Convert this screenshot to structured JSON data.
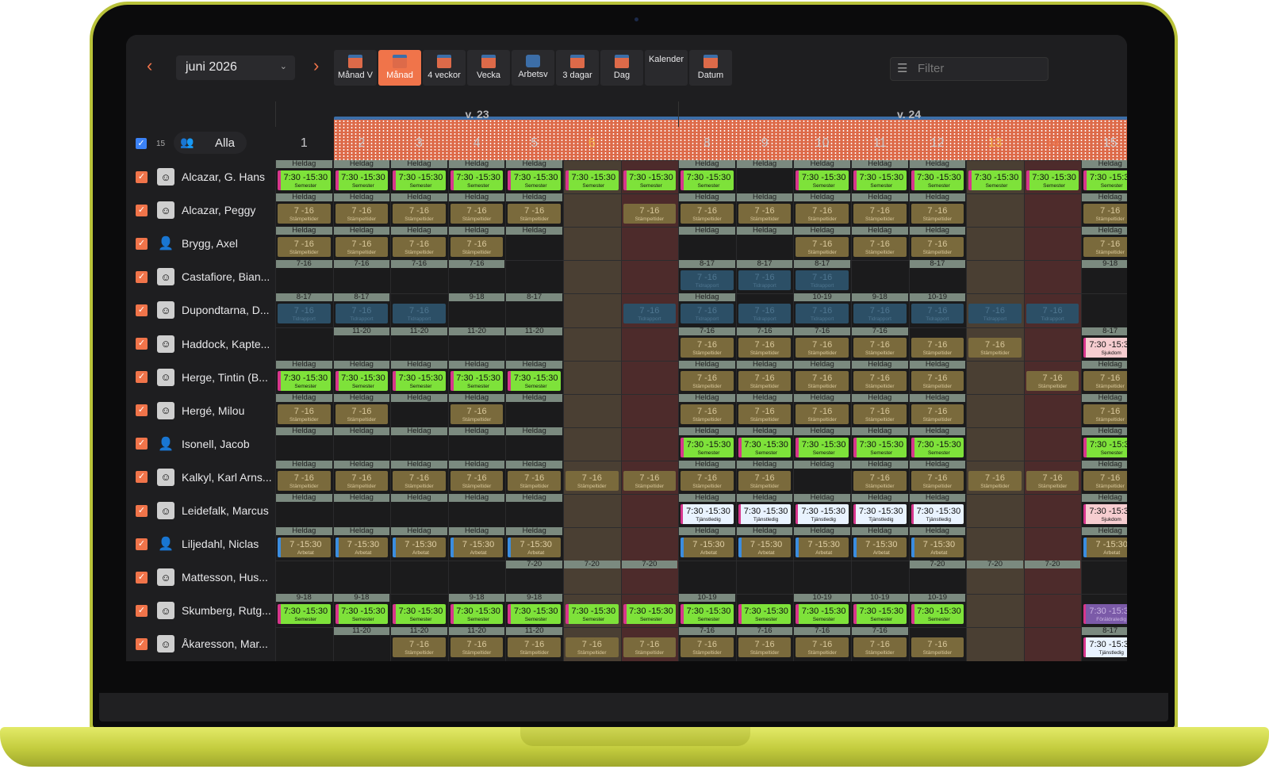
{
  "toolbar": {
    "month": "juni 2026",
    "views": [
      {
        "label": "Månad V",
        "icon": "calendar-icon"
      },
      {
        "label": "Månad",
        "icon": "calendar-icon",
        "active": true
      },
      {
        "label": "4 veckor",
        "icon": "calendar-icon"
      },
      {
        "label": "Vecka",
        "icon": "calendar-week-icon"
      },
      {
        "label": "Arbetsv",
        "icon": "briefcase-icon"
      },
      {
        "label": "3 dagar",
        "icon": "calendar-icon"
      },
      {
        "label": "Dag",
        "icon": "calendar-day-icon"
      },
      {
        "label": "Kalender",
        "icon": "calendar-grid-icon"
      },
      {
        "label": "Datum",
        "icon": "calendar-icon"
      }
    ],
    "filter_placeholder": "Filter"
  },
  "weeks": [
    {
      "label": "v. 23"
    },
    {
      "label": "v. 24"
    }
  ],
  "all": {
    "count": "15",
    "label": "Alla"
  },
  "days": [
    {
      "n": "1",
      "t": "wk"
    },
    {
      "n": "2",
      "t": "wk"
    },
    {
      "n": "3",
      "t": "wk"
    },
    {
      "n": "4",
      "t": "wk"
    },
    {
      "n": "5",
      "t": "wk"
    },
    {
      "n": "6",
      "t": "sat"
    },
    {
      "n": "7",
      "t": "sun"
    },
    {
      "n": "8",
      "t": "wk"
    },
    {
      "n": "9",
      "t": "wk"
    },
    {
      "n": "10",
      "t": "wk"
    },
    {
      "n": "11",
      "t": "wk"
    },
    {
      "n": "12",
      "t": "wk"
    },
    {
      "n": "13",
      "t": "sat"
    },
    {
      "n": "14",
      "t": "sun"
    },
    {
      "n": "15",
      "t": "wk"
    }
  ],
  "legend": {
    "sem": {
      "time": "7:30 -15:30",
      "label": "Semester"
    },
    "stamp": {
      "time": "7 -16",
      "label": "Stämpeltider"
    },
    "tid": {
      "time": "7 -16",
      "label": "Tidrapport"
    },
    "arb": {
      "time": "7 -15:30",
      "label": "Arbetat"
    },
    "tjan": {
      "time": "7:30 -15:30",
      "label": "Tjänstledig"
    },
    "sjuk": {
      "time": "7:30 -15:30",
      "label": "Sjukdom"
    },
    "parent": {
      "time": "7:30 -15:30",
      "label": "Föräldraledig"
    }
  },
  "people": [
    {
      "name": "Alcazar, G. Hans",
      "avatar": "person-photo-icon",
      "cells": [
        [
          "Heldag",
          "sem"
        ],
        [
          "Heldag",
          "sem"
        ],
        [
          "Heldag",
          "sem"
        ],
        [
          "Heldag",
          "sem"
        ],
        [
          "Heldag",
          "sem"
        ],
        [
          "",
          "sem"
        ],
        [
          "",
          "sem"
        ],
        [
          "Heldag",
          "sem"
        ],
        [
          "Heldag",
          ""
        ],
        [
          "Heldag",
          "sem"
        ],
        [
          "Heldag",
          "sem"
        ],
        [
          "Heldag",
          "sem"
        ],
        [
          "",
          "sem"
        ],
        [
          "",
          "sem"
        ],
        [
          "Heldag",
          "sem"
        ]
      ]
    },
    {
      "name": "Alcazar, Peggy",
      "avatar": "person-photo-icon",
      "cells": [
        [
          "Heldag",
          "stamp"
        ],
        [
          "Heldag",
          "stamp"
        ],
        [
          "Heldag",
          "stamp"
        ],
        [
          "Heldag",
          "stamp"
        ],
        [
          "Heldag",
          "stamp"
        ],
        [
          "",
          ""
        ],
        [
          "",
          "stamp"
        ],
        [
          "Heldag",
          "stamp"
        ],
        [
          "Heldag",
          "stamp"
        ],
        [
          "Heldag",
          "stamp"
        ],
        [
          "Heldag",
          "stamp"
        ],
        [
          "Heldag",
          "stamp"
        ],
        [
          "",
          ""
        ],
        [
          "",
          ""
        ],
        [
          "Heldag",
          "stamp"
        ]
      ]
    },
    {
      "name": "Brygg, Axel",
      "avatar": "generic-user-icon",
      "cells": [
        [
          "Heldag",
          "stamp"
        ],
        [
          "Heldag",
          "stamp"
        ],
        [
          "Heldag",
          "stamp"
        ],
        [
          "Heldag",
          "stamp"
        ],
        [
          "Heldag",
          ""
        ],
        [
          "",
          ""
        ],
        [
          "",
          ""
        ],
        [
          "Heldag",
          ""
        ],
        [
          "Heldag",
          ""
        ],
        [
          "Heldag",
          "stamp"
        ],
        [
          "Heldag",
          "stamp"
        ],
        [
          "Heldag",
          "stamp"
        ],
        [
          "",
          ""
        ],
        [
          "",
          ""
        ],
        [
          "Heldag",
          "stamp"
        ]
      ]
    },
    {
      "name": "Castafiore, Bian...",
      "avatar": "person-photo-icon",
      "cells": [
        [
          "7-16",
          ""
        ],
        [
          "7-16",
          ""
        ],
        [
          "7-16",
          ""
        ],
        [
          "7-16",
          ""
        ],
        [
          "",
          ""
        ],
        [
          "",
          ""
        ],
        [
          "",
          ""
        ],
        [
          "8-17",
          "tid"
        ],
        [
          "8-17",
          "tid"
        ],
        [
          "8-17",
          "tid"
        ],
        [
          "",
          ""
        ],
        [
          "8-17",
          ""
        ],
        [
          "",
          ""
        ],
        [
          "",
          ""
        ],
        [
          "9-18",
          ""
        ]
      ]
    },
    {
      "name": "Dupondtarna, D...",
      "avatar": "person-photo-icon",
      "cells": [
        [
          "8-17",
          "tid"
        ],
        [
          "8-17",
          "tid"
        ],
        [
          "",
          "tid"
        ],
        [
          "9-18",
          ""
        ],
        [
          "8-17",
          ""
        ],
        [
          "",
          ""
        ],
        [
          "",
          "tid"
        ],
        [
          "Heldag",
          "tid"
        ],
        [
          "",
          "tid"
        ],
        [
          "10-19",
          "tid"
        ],
        [
          "9-18",
          "tid"
        ],
        [
          "10-19",
          "tid"
        ],
        [
          "",
          "tid"
        ],
        [
          "",
          "tid"
        ],
        [
          "",
          ""
        ]
      ]
    },
    {
      "name": "Haddock, Kapte...",
      "avatar": "person-photo-icon",
      "cells": [
        [
          "",
          ""
        ],
        [
          "11-20",
          ""
        ],
        [
          "11-20",
          ""
        ],
        [
          "11-20",
          ""
        ],
        [
          "11-20",
          ""
        ],
        [
          "",
          ""
        ],
        [
          "",
          ""
        ],
        [
          "7-16",
          "stamp"
        ],
        [
          "7-16",
          "stamp"
        ],
        [
          "7-16",
          "stamp"
        ],
        [
          "7-16",
          "stamp"
        ],
        [
          "",
          "stamp"
        ],
        [
          "",
          "stamp"
        ],
        [
          "",
          ""
        ],
        [
          "8-17",
          "sjuk"
        ]
      ]
    },
    {
      "name": "Herge, Tintin (B...",
      "avatar": "person-photo-icon",
      "cells": [
        [
          "Heldag",
          "sem"
        ],
        [
          "Heldag",
          "sem"
        ],
        [
          "Heldag",
          "sem"
        ],
        [
          "Heldag",
          "sem"
        ],
        [
          "Heldag",
          "sem"
        ],
        [
          "",
          ""
        ],
        [
          "",
          ""
        ],
        [
          "Heldag",
          "stamp"
        ],
        [
          "Heldag",
          "stamp"
        ],
        [
          "Heldag",
          "stamp"
        ],
        [
          "Heldag",
          "stamp"
        ],
        [
          "Heldag",
          "stamp"
        ],
        [
          "",
          ""
        ],
        [
          "",
          "stamp"
        ],
        [
          "Heldag",
          "stamp"
        ]
      ]
    },
    {
      "name": "Hergé, Milou",
      "avatar": "person-photo-icon",
      "cells": [
        [
          "Heldag",
          "stamp"
        ],
        [
          "Heldag",
          "stamp"
        ],
        [
          "Heldag",
          ""
        ],
        [
          "Heldag",
          "stamp"
        ],
        [
          "Heldag",
          ""
        ],
        [
          "",
          ""
        ],
        [
          "",
          ""
        ],
        [
          "Heldag",
          "stamp"
        ],
        [
          "Heldag",
          "stamp"
        ],
        [
          "Heldag",
          "stamp"
        ],
        [
          "Heldag",
          "stamp"
        ],
        [
          "Heldag",
          "stamp"
        ],
        [
          "",
          ""
        ],
        [
          "",
          ""
        ],
        [
          "Heldag",
          "stamp"
        ]
      ]
    },
    {
      "name": "Isonell, Jacob",
      "avatar": "generic-user-icon",
      "cells": [
        [
          "Heldag",
          ""
        ],
        [
          "Heldag",
          ""
        ],
        [
          "Heldag",
          ""
        ],
        [
          "Heldag",
          ""
        ],
        [
          "Heldag",
          ""
        ],
        [
          "",
          ""
        ],
        [
          "",
          ""
        ],
        [
          "Heldag",
          "sem"
        ],
        [
          "Heldag",
          "sem"
        ],
        [
          "Heldag",
          "sem"
        ],
        [
          "Heldag",
          "sem"
        ],
        [
          "Heldag",
          "sem"
        ],
        [
          "",
          ""
        ],
        [
          "",
          ""
        ],
        [
          "Heldag",
          "sem"
        ]
      ]
    },
    {
      "name": "Kalkyl, Karl Arns...",
      "avatar": "person-photo-icon",
      "cells": [
        [
          "Heldag",
          "stamp"
        ],
        [
          "Heldag",
          "stamp"
        ],
        [
          "Heldag",
          "stamp"
        ],
        [
          "Heldag",
          "stamp"
        ],
        [
          "Heldag",
          "stamp"
        ],
        [
          "",
          "stamp"
        ],
        [
          "",
          "stamp"
        ],
        [
          "Heldag",
          "stamp"
        ],
        [
          "Heldag",
          "stamp"
        ],
        [
          "Heldag",
          ""
        ],
        [
          "Heldag",
          "stamp"
        ],
        [
          "Heldag",
          "stamp"
        ],
        [
          "",
          "stamp"
        ],
        [
          "",
          "stamp"
        ],
        [
          "Heldag",
          "stamp"
        ]
      ]
    },
    {
      "name": "Leidefalk, Marcus",
      "avatar": "person-photo-icon",
      "cells": [
        [
          "Heldag",
          ""
        ],
        [
          "Heldag",
          ""
        ],
        [
          "Heldag",
          ""
        ],
        [
          "Heldag",
          ""
        ],
        [
          "Heldag",
          ""
        ],
        [
          "",
          ""
        ],
        [
          "",
          ""
        ],
        [
          "Heldag",
          "tjan"
        ],
        [
          "Heldag",
          "tjan"
        ],
        [
          "Heldag",
          "tjan"
        ],
        [
          "Heldag",
          "tjan"
        ],
        [
          "Heldag",
          "tjan"
        ],
        [
          "",
          ""
        ],
        [
          "",
          ""
        ],
        [
          "Heldag",
          "sjuk"
        ]
      ]
    },
    {
      "name": "Liljedahl, Niclas",
      "avatar": "generic-user-icon",
      "cells": [
        [
          "Heldag",
          "arb"
        ],
        [
          "Heldag",
          "arb"
        ],
        [
          "Heldag",
          "arb"
        ],
        [
          "Heldag",
          "arb"
        ],
        [
          "Heldag",
          "arb"
        ],
        [
          "",
          ""
        ],
        [
          "",
          ""
        ],
        [
          "Heldag",
          "arb"
        ],
        [
          "Heldag",
          "arb"
        ],
        [
          "Heldag",
          "arb"
        ],
        [
          "Heldag",
          "arb"
        ],
        [
          "Heldag",
          "arb"
        ],
        [
          "",
          ""
        ],
        [
          "",
          ""
        ],
        [
          "Heldag",
          "arb"
        ]
      ]
    },
    {
      "name": "Mattesson, Hus...",
      "avatar": "person-photo-icon",
      "cells": [
        [
          "",
          ""
        ],
        [
          "",
          ""
        ],
        [
          "",
          ""
        ],
        [
          "",
          ""
        ],
        [
          "7-20",
          ""
        ],
        [
          "7-20",
          ""
        ],
        [
          "7-20",
          ""
        ],
        [
          "",
          ""
        ],
        [
          "",
          ""
        ],
        [
          "",
          ""
        ],
        [
          "",
          ""
        ],
        [
          "7-20",
          ""
        ],
        [
          "7-20",
          ""
        ],
        [
          "7-20",
          ""
        ],
        [
          "",
          ""
        ]
      ]
    },
    {
      "name": "Skumberg, Rutg...",
      "avatar": "person-photo-icon",
      "cells": [
        [
          "9-18",
          "sem"
        ],
        [
          "9-18",
          "sem"
        ],
        [
          "",
          "sem"
        ],
        [
          "9-18",
          "sem"
        ],
        [
          "9-18",
          "sem"
        ],
        [
          "",
          "sem"
        ],
        [
          "",
          "sem"
        ],
        [
          "10-19",
          "sem"
        ],
        [
          "",
          "sem"
        ],
        [
          "10-19",
          "sem"
        ],
        [
          "10-19",
          "sem"
        ],
        [
          "10-19",
          "sem"
        ],
        [
          "",
          ""
        ],
        [
          "",
          ""
        ],
        [
          "",
          "parent"
        ]
      ]
    },
    {
      "name": "Åkaresson, Mar...",
      "avatar": "person-photo-icon",
      "cells": [
        [
          "",
          ""
        ],
        [
          "11-20",
          ""
        ],
        [
          "11-20",
          "stamp"
        ],
        [
          "11-20",
          "stamp"
        ],
        [
          "11-20",
          "stamp"
        ],
        [
          "",
          "stamp"
        ],
        [
          "",
          "stamp"
        ],
        [
          "7-16",
          "stamp"
        ],
        [
          "7-16",
          "stamp"
        ],
        [
          "7-16",
          "stamp"
        ],
        [
          "7-16",
          "stamp"
        ],
        [
          "",
          "stamp"
        ],
        [
          "",
          ""
        ],
        [
          "",
          ""
        ],
        [
          "8-17",
          "tjan"
        ]
      ]
    }
  ]
}
